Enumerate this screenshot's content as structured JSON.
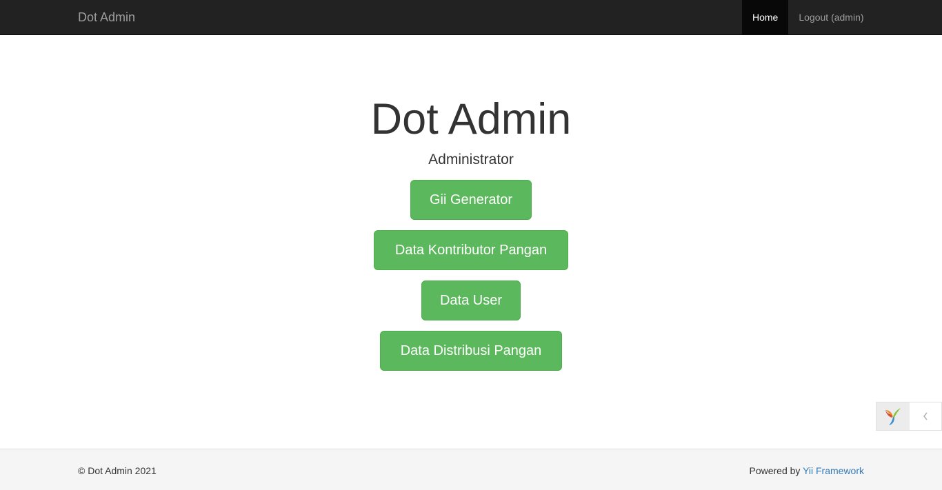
{
  "navbar": {
    "brand": "Dot Admin",
    "items": [
      {
        "label": "Home",
        "active": true
      },
      {
        "label": "Logout (admin)",
        "active": false
      }
    ]
  },
  "jumbotron": {
    "title": "Dot Admin",
    "subtitle": "Administrator",
    "buttons": [
      {
        "label": "Gii Generator"
      },
      {
        "label": "Data Kontributor Pangan"
      },
      {
        "label": "Data User"
      },
      {
        "label": "Data Distribusi Pangan"
      }
    ]
  },
  "debug_toolbar": {
    "logo_icon": "yii-logo-icon",
    "toggle_icon": "chevron-left-icon"
  },
  "footer": {
    "copyright": "© Dot Admin 2021",
    "powered_prefix": "Powered by",
    "powered_link": "Yii Framework"
  },
  "colors": {
    "navbar_bg": "#222222",
    "active_nav_bg": "#080808",
    "button_green": "#5cb85c",
    "link_blue": "#337ab7",
    "footer_bg": "#f5f5f5"
  }
}
